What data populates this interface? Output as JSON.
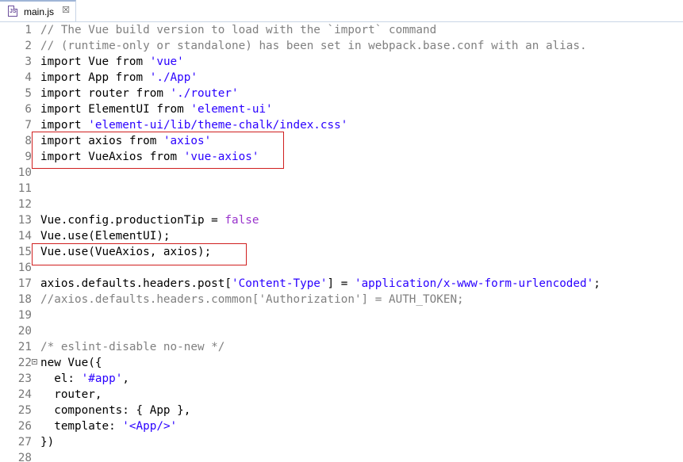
{
  "tab": {
    "label": "main.js",
    "icon": "js-file-icon",
    "icon_text": "JS",
    "close": "☒"
  },
  "colors": {
    "keyword": "#000000",
    "string": "#2a00ff",
    "comment": "#808080",
    "boolean": "#9933cc",
    "highlight_box": "#d01f1f"
  },
  "lines": [
    {
      "n": "1",
      "parts": [
        {
          "t": "// The Vue build version to load with the `import` command",
          "c": "cm"
        }
      ]
    },
    {
      "n": "2",
      "parts": [
        {
          "t": "// (runtime-only or standalone) has been set in webpack.base.conf with an alias.",
          "c": "cm"
        }
      ]
    },
    {
      "n": "3",
      "parts": [
        {
          "t": "import Vue from ",
          "c": ""
        },
        {
          "t": "'vue'",
          "c": "s"
        }
      ]
    },
    {
      "n": "4",
      "parts": [
        {
          "t": "import App from ",
          "c": ""
        },
        {
          "t": "'./App'",
          "c": "s"
        }
      ]
    },
    {
      "n": "5",
      "parts": [
        {
          "t": "import router from ",
          "c": ""
        },
        {
          "t": "'./router'",
          "c": "s"
        }
      ]
    },
    {
      "n": "6",
      "parts": [
        {
          "t": "import ElementUI from ",
          "c": ""
        },
        {
          "t": "'element-ui'",
          "c": "s"
        }
      ]
    },
    {
      "n": "7",
      "parts": [
        {
          "t": "import ",
          "c": ""
        },
        {
          "t": "'element-ui/lib/theme-chalk/index.css'",
          "c": "s"
        }
      ]
    },
    {
      "n": "8",
      "parts": [
        {
          "t": "import axios from ",
          "c": ""
        },
        {
          "t": "'axios'",
          "c": "s"
        }
      ]
    },
    {
      "n": "9",
      "parts": [
        {
          "t": "import VueAxios from ",
          "c": ""
        },
        {
          "t": "'vue-axios'",
          "c": "s"
        }
      ]
    },
    {
      "n": "10",
      "parts": []
    },
    {
      "n": "11",
      "parts": []
    },
    {
      "n": "12",
      "parts": []
    },
    {
      "n": "13",
      "parts": [
        {
          "t": "Vue.config.productionTip = ",
          "c": ""
        },
        {
          "t": "false",
          "c": "b"
        }
      ]
    },
    {
      "n": "14",
      "parts": [
        {
          "t": "Vue.use(ElementUI);",
          "c": ""
        }
      ]
    },
    {
      "n": "15",
      "parts": [
        {
          "t": "Vue.use(VueAxios, axios);",
          "c": ""
        }
      ]
    },
    {
      "n": "16",
      "parts": []
    },
    {
      "n": "17",
      "parts": [
        {
          "t": "axios.defaults.headers.post[",
          "c": ""
        },
        {
          "t": "'Content-Type'",
          "c": "s"
        },
        {
          "t": "] = ",
          "c": ""
        },
        {
          "t": "'application/x-www-form-urlencoded'",
          "c": "s"
        },
        {
          "t": ";",
          "c": ""
        }
      ]
    },
    {
      "n": "18",
      "parts": [
        {
          "t": "//axios.defaults.headers.common['Authorization'] = AUTH_TOKEN;",
          "c": "cm"
        }
      ]
    },
    {
      "n": "19",
      "parts": []
    },
    {
      "n": "20",
      "parts": []
    },
    {
      "n": "21",
      "parts": [
        {
          "t": "/* eslint-disable no-new */",
          "c": "cm"
        }
      ]
    },
    {
      "n": "22",
      "fold": true,
      "parts": [
        {
          "t": "new Vue({",
          "c": ""
        }
      ]
    },
    {
      "n": "23",
      "parts": [
        {
          "t": "  el: ",
          "c": ""
        },
        {
          "t": "'#app'",
          "c": "s"
        },
        {
          "t": ",",
          "c": ""
        }
      ]
    },
    {
      "n": "24",
      "parts": [
        {
          "t": "  router,",
          "c": ""
        }
      ]
    },
    {
      "n": "25",
      "parts": [
        {
          "t": "  components: { App },",
          "c": ""
        }
      ]
    },
    {
      "n": "26",
      "parts": [
        {
          "t": "  template: ",
          "c": ""
        },
        {
          "t": "'<App/>'",
          "c": "s"
        }
      ]
    },
    {
      "n": "27",
      "parts": [
        {
          "t": "})",
          "c": ""
        }
      ]
    },
    {
      "n": "28",
      "parts": []
    }
  ]
}
